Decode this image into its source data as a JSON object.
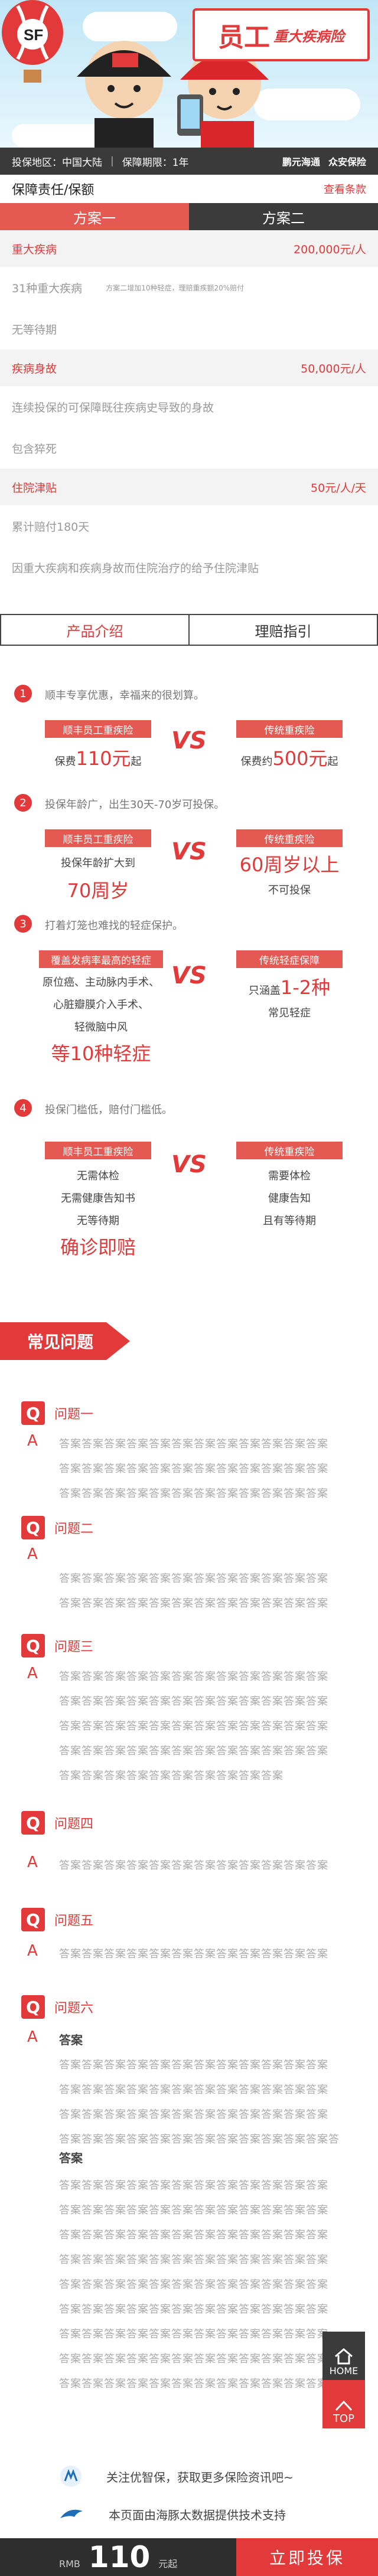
{
  "banner": {
    "title_big": "员工",
    "title_small": "重大疾病险"
  },
  "info": {
    "region_label": "投保地区：",
    "region": "中国大陆",
    "period_label": "保障期限：",
    "period": "1年",
    "logo1": "鹏元海通",
    "logo2": "众安保险"
  },
  "coverage": {
    "header": "保障责任/保额",
    "link": "查看条款",
    "tabs": [
      "方案一",
      "方案二"
    ],
    "rows": [
      {
        "name": "重大疾病",
        "amount": "200,000元/人"
      },
      {
        "text": "31种重大疾病",
        "note": "方案二增加10种轻症，理赔重疾额20%赔付"
      },
      {
        "text": "无等待期"
      },
      {
        "name": "疾病身故",
        "amount": "50,000元/人"
      },
      {
        "text": "连续投保的可保障既往疾病史导致的身故"
      },
      {
        "text": "包含猝死"
      },
      {
        "name": "住院津贴",
        "amount": "50元/人/天"
      },
      {
        "text": "累计赔付180天"
      },
      {
        "text": "因重大疾病和疾病身故而住院治疗的给予住院津贴"
      }
    ]
  },
  "tabs2": [
    "产品介绍",
    "理赔指引"
  ],
  "features": [
    {
      "num": "1",
      "title": "顺丰专享优惠，幸福来的很划算。",
      "left": {
        "label": "顺丰员工重疾险",
        "lines": [
          {
            "pre": "保费",
            "hl": "110元",
            "post": "起"
          }
        ]
      },
      "right": {
        "label": "传统重疾险",
        "lines": [
          {
            "pre": "保费约",
            "hl": "500元",
            "post": "起"
          }
        ]
      }
    },
    {
      "num": "2",
      "title": "投保年龄广，出生30天-70岁可投保。",
      "left": {
        "label": "顺丰员工重疾险",
        "l1": "投保年龄扩大到",
        "l2": "70周岁"
      },
      "right": {
        "label": "传统重疾险",
        "l1": "60周岁以上",
        "l2": "不可投保"
      }
    },
    {
      "num": "3",
      "title": "打着灯笼也难找的轻症保护。",
      "left": {
        "label": "覆盖发病率最高的轻症",
        "l1": "原位癌、主动脉内手术、",
        "l2": "心脏瓣膜介入手术、",
        "l3": "轻微脑中风",
        "l4": "等10种轻症"
      },
      "right": {
        "label": "传统轻症保障",
        "l1pre": "只涵盖",
        "l1hl": "1-2种",
        "l2": "常见轻症"
      }
    },
    {
      "num": "4",
      "title": "投保门槛低，赔付门槛低。",
      "left": {
        "label": "顺丰员工重疾险",
        "l1": "无需体检",
        "l2": "无需健康告知书",
        "l3": "无等待期",
        "l4": "确诊即赔"
      },
      "right": {
        "label": "传统重疾险",
        "l1": "需要体检",
        "l2": "健康告知",
        "l3": "且有等待期"
      }
    }
  ],
  "vs": "VS",
  "faq": {
    "title": "常见问题",
    "q": "Q",
    "a": "A",
    "answer_text": "答案答案答案答案答案答案答案答案答案答案答案答案",
    "answer_short": "答案答案答案答案答案答案答案答案答案答案",
    "answer_mid": "答案答案答案答案答案答案答案答案答案答案答案答案答",
    "bold_label": "答案",
    "questions": [
      "问题一",
      "问题二",
      "问题三",
      "问题四",
      "问题五",
      "问题六"
    ]
  },
  "buttons": {
    "home": "HOME",
    "top": "TOP"
  },
  "footer": {
    "follow": "关注优智保，获取更多保险资讯吧~",
    "support": "本页面由海豚太数据提供技术支持",
    "currency": "RMB",
    "price": "110",
    "unit": "元起",
    "buy": "立即投保"
  },
  "colors": {
    "accent": "#e23a3a",
    "dark": "#3b3b3b"
  }
}
